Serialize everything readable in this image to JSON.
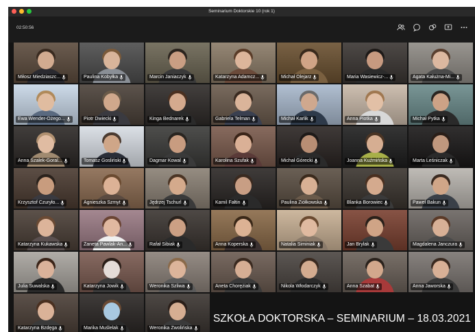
{
  "window": {
    "title": "Seminarium Doktorskie 10 (rok 1)",
    "traffic_colors": [
      "#ff5f57",
      "#febc2e",
      "#28c840"
    ]
  },
  "toolbar": {
    "timer": "02:50:56",
    "icons": [
      "participants-icon",
      "chat-icon",
      "reactions-icon",
      "share-screen-icon",
      "more-options-icon"
    ]
  },
  "participants": [
    {
      "name": "Miłosz Miedziaszc...",
      "bg": "#5b4a3c",
      "hair": "#3a2b20",
      "skin": "#d2ab90",
      "shirt": "#2a2a30"
    },
    {
      "name": "Paulina Kobyłka",
      "bg": "#4c4c4c",
      "hair": "#7a5a3a",
      "skin": "#d8b49a",
      "shirt": "#8a8f96"
    },
    {
      "name": "Marcin Janiaczyk",
      "bg": "#6a6452",
      "hair": "#2b241e",
      "skin": "#c99e83",
      "shirt": "#3a3a3a"
    },
    {
      "name": "Katarzyna Adamcz...",
      "bg": "#8a7a66",
      "hair": "#5a3c28",
      "skin": "#dcb59b",
      "shirt": "#6b4a3a"
    },
    {
      "name": "Michał Olejarz",
      "bg": "#6a5030",
      "hair": "#3a2a1c",
      "skin": "#d0a486",
      "shirt": "#7a6040"
    },
    {
      "name": "Maria Wasiewicz-...",
      "bg": "#3a3532",
      "hair": "#1e1a18",
      "skin": "#c79a80",
      "shirt": "#2c2c2c"
    },
    {
      "name": "Agata Kałużna-Mi...",
      "bg": "#8e8a84",
      "hair": "#5a4030",
      "skin": "#dcb8a0",
      "shirt": "#4a4a4a"
    },
    {
      "name": "Ewa Wender-Ożego...",
      "bg": "#c7d6e6",
      "hair": "#b08a5a",
      "skin": "#e0bca0",
      "shirt": "#5a6a80"
    },
    {
      "name": "Piotr Dwiecki",
      "bg": "#4a4038",
      "hair": "#6a5a48",
      "skin": "#d0a88c",
      "shirt": "#3a3a40"
    },
    {
      "name": "Kinga Bednarek",
      "bg": "#2e2a28",
      "hair": "#4a3020",
      "skin": "#d4aa8e",
      "shirt": "#2a2a2a"
    },
    {
      "name": "Gabriela Telman",
      "bg": "#6a5a4c",
      "hair": "#3a2a20",
      "skin": "#dab49a",
      "shirt": "#3a4050"
    },
    {
      "name": "Michał Karlik",
      "bg": "#a8b8cc",
      "hair": "#6a6a6a",
      "skin": "#cfa88e",
      "shirt": "#2e3a4a"
    },
    {
      "name": "Anna Piotka",
      "bg": "#c8b8a8",
      "hair": "#a07850",
      "skin": "#e2c0a6",
      "shirt": "#d8d8d8"
    },
    {
      "name": "Michał Pytka",
      "bg": "#6a8a8a",
      "hair": "#2a2420",
      "skin": "#cda286",
      "shirt": "#2a2a2a"
    },
    {
      "name": "Anna Szalek-Goral...",
      "bg": "#2c2826",
      "hair": "#b09070",
      "skin": "#e0bca2",
      "shirt": "#a08a70"
    },
    {
      "name": "Tomasz Gosliński",
      "bg": "#d8dde4",
      "hair": "#4a3a30",
      "skin": "#cfa688",
      "shirt": "#2a2e38"
    },
    {
      "name": "Dagmar Kowal",
      "bg": "#3a3a38",
      "hair": "#2a2520",
      "skin": "#c89c80",
      "shirt": "#3a3a3a"
    },
    {
      "name": "Karolina Szufak",
      "bg": "#7a5a4c",
      "hair": "#3a2418",
      "skin": "#dab096",
      "shirt": "#5a3a38"
    },
    {
      "name": "Michał Górecki",
      "bg": "#2a2422",
      "hair": "#1e1a18",
      "skin": "#b88e74",
      "shirt": "#2a2a2a"
    },
    {
      "name": "Joanna Kuźmińska",
      "bg": "#1e1e1e",
      "hair": "#4a3424",
      "skin": "#d6ae92",
      "shirt": "#a8b048"
    },
    {
      "name": "Marta Leśniczak",
      "bg": "#1a1818",
      "hair": "#2a1e18",
      "skin": "#c0987e",
      "shirt": "#2a2a2a"
    },
    {
      "name": "Krzysztof Czuryło...",
      "bg": "#4a3a30",
      "hair": "#2a221c",
      "skin": "#c89c7e",
      "shirt": "#3a3a40"
    },
    {
      "name": "Agnieszka Szmyt",
      "bg": "#8a6a50",
      "hair": "#6a4a30",
      "skin": "#dcb296",
      "shirt": "#5a4a40"
    },
    {
      "name": "Jędrzej Tschurl",
      "bg": "#8a8074",
      "hair": "#4a3424",
      "skin": "#d4aa8c",
      "shirt": "#3a3a3a"
    },
    {
      "name": "Kamil Fałtin",
      "bg": "#2a2624",
      "hair": "#3a2a20",
      "skin": "#c89e84",
      "shirt": "#2a2a2a"
    },
    {
      "name": "Paulina Ziółkowska",
      "bg": "#5a4e42",
      "hair": "#3a2a1c",
      "skin": "#d8b094",
      "shirt": "#6a5a4a"
    },
    {
      "name": "Blanka Borowiec",
      "bg": "#3a342e",
      "hair": "#4a3020",
      "skin": "#d4aa8e",
      "shirt": "#3a3a3a"
    },
    {
      "name": "Paweł Bakun",
      "bg": "#b8b4ae",
      "hair": "#3a2a20",
      "skin": "#d0a688",
      "shirt": "#3a4048"
    },
    {
      "name": "Katarzyna Kukawska",
      "bg": "#4a3e36",
      "hair": "#6a4a34",
      "skin": "#dcb49a",
      "shirt": "#5a5050"
    },
    {
      "name": "Żaneta Pawlak-An...",
      "bg": "#9a7a84",
      "hair": "#6a4434",
      "skin": "#e0b8a0",
      "shirt": "#f0f0f0"
    },
    {
      "name": "Rafał Sibiak",
      "bg": "#3a3430",
      "hair": "#2a221c",
      "skin": "#cca084",
      "shirt": "#2a2a2a"
    },
    {
      "name": "Anna Koperska",
      "bg": "#8a6a48",
      "hair": "#3a2818",
      "skin": "#dcb294",
      "shirt": "#3a3030"
    },
    {
      "name": "Natalia Siminiak",
      "bg": "#c8b094",
      "hair": "#6a4a30",
      "skin": "#e0baa0",
      "shirt": "#8a7a6a"
    },
    {
      "name": "Jan Brylak",
      "bg": "#7a4030",
      "hair": "#2a201a",
      "skin": "#cfa486",
      "shirt": "#3a3a3a"
    },
    {
      "name": "Magdalena Janczura",
      "bg": "#6a6460",
      "hair": "#5a3a28",
      "skin": "#d8b096",
      "shirt": "#4a4a4a"
    },
    {
      "name": "Julia Suwalska",
      "bg": "#a8a49e",
      "hair": "#3a2418",
      "skin": "#dab29a",
      "shirt": "#2a2a2a"
    },
    {
      "name": "Katarzyna Jowik",
      "bg": "#7a5a50",
      "hair": "#2a1e18",
      "skin": "#e4dcd8",
      "shirt": "#3a3a3a"
    },
    {
      "name": "Weronika Szliwa",
      "bg": "#8a8078",
      "hair": "#8a6a4a",
      "skin": "#dcb49a",
      "shirt": "#5a5a5a"
    },
    {
      "name": "Aneta Chorężiak",
      "bg": "#6a5a50",
      "hair": "#3a2a20",
      "skin": "#d6ae94",
      "shirt": "#3a3a3a"
    },
    {
      "name": "Nikola Włodarczyk",
      "bg": "#4a4440",
      "hair": "#3a2a20",
      "skin": "#d4ac90",
      "shirt": "#2a2a2a"
    },
    {
      "name": "Anna Szabat",
      "bg": "#6a6058",
      "hair": "#2a221c",
      "skin": "#d2a88c",
      "shirt": "#a83a3a"
    },
    {
      "name": "Anna Jaworska",
      "bg": "#7a7470",
      "hair": "#3a2a20",
      "skin": "#d8b096",
      "shirt": "#3a3a3a"
    },
    {
      "name": "Katarzyna Bzdęga",
      "bg": "#4a3e36",
      "hair": "#4a3020",
      "skin": "#dab298",
      "shirt": "#3a3a3a"
    },
    {
      "name": "Marika Muślelak",
      "bg": "#2a2624",
      "hair": "#6a4a34",
      "skin": "#a8c8e0",
      "shirt": "#2a2a2a"
    },
    {
      "name": "Weronika Zwolińska",
      "bg": "#3a3430",
      "hair": "#2a1e18",
      "skin": "#d6ae92",
      "shirt": "#3a3a3a"
    }
  ],
  "caption": "SZKOŁA DOKTORSKA – SEMINARIUM – 18.03.2021"
}
